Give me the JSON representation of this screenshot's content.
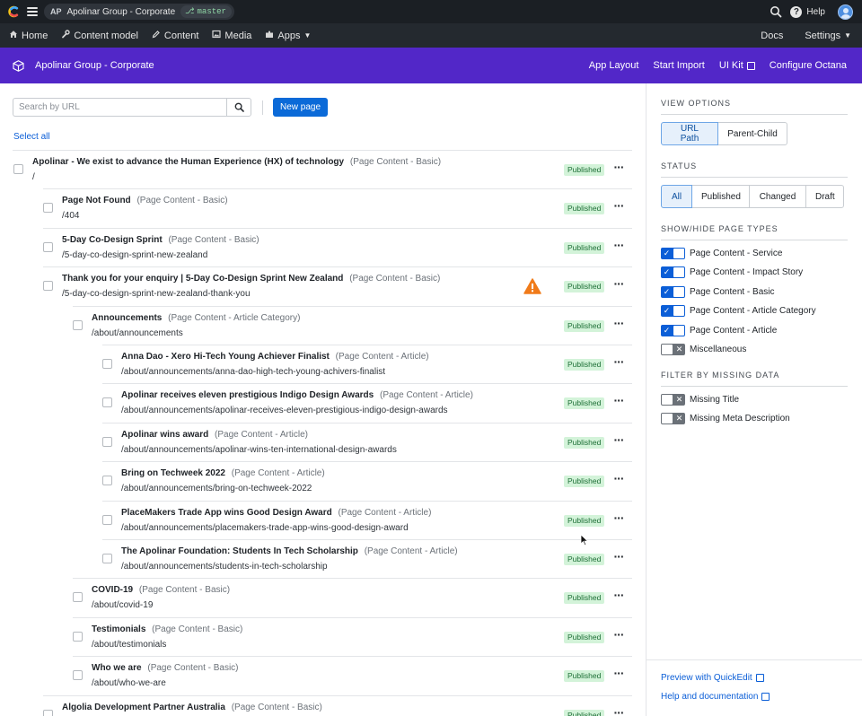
{
  "topbar": {
    "project_initials": "AP",
    "project_name": "Apolinar Group - Corporate",
    "branch": "master",
    "help_label": "Help",
    "icons": [
      "contentful-logo",
      "hamburger-icon",
      "branch-icon",
      "search-icon",
      "help-icon",
      "avatar"
    ]
  },
  "nav": {
    "home": "Home",
    "content_model": "Content model",
    "content": "Content",
    "media": "Media",
    "apps": "Apps",
    "docs": "Docs",
    "settings": "Settings"
  },
  "header": {
    "title": "Apolinar Group - Corporate",
    "links": {
      "app_layout": "App Layout",
      "start_import": "Start Import",
      "ui_kit": "UI Kit",
      "configure": "Configure Octana"
    },
    "accent": "#5227c8"
  },
  "toolbar": {
    "search_placeholder": "Search by URL",
    "new_page": "New page",
    "select_all": "Select all"
  },
  "rows": [
    {
      "title": "Apolinar - We exist to advance the Human Experience (HX) of technology",
      "type": "(Page Content - Basic)",
      "path": "/",
      "status": "Published"
    },
    {
      "title": "Page Not Found",
      "type": "(Page Content - Basic)",
      "path": "/404",
      "status": "Published"
    },
    {
      "title": "5-Day Co-Design Sprint",
      "type": "(Page Content - Basic)",
      "path": "/5-day-co-design-sprint-new-zealand",
      "status": "Published"
    },
    {
      "title": "Thank you for your enquiry | 5-Day Co-Design Sprint New Zealand",
      "type": "(Page Content - Basic)",
      "path": "/5-day-co-design-sprint-new-zealand-thank-you",
      "status": "Published",
      "warning": true
    },
    {
      "title": "Announcements",
      "type": "(Page Content - Article Category)",
      "path": "/about/announcements",
      "status": "Published"
    },
    {
      "title": "Anna Dao - Xero Hi-Tech Young Achiever Finalist",
      "type": "(Page Content - Article)",
      "path": "/about/announcements/anna-dao-high-tech-young-achivers-finalist",
      "status": "Published"
    },
    {
      "title": "Apolinar receives eleven prestigious Indigo Design Awards",
      "type": "(Page Content - Article)",
      "path": "/about/announcements/apolinar-receives-eleven-prestigious-indigo-design-awards",
      "status": "Published"
    },
    {
      "title": "Apolinar wins award",
      "type": "(Page Content - Article)",
      "path": "/about/announcements/apolinar-wins-ten-international-design-awards",
      "status": "Published"
    },
    {
      "title": "Bring on Techweek 2022",
      "type": "(Page Content - Article)",
      "path": "/about/announcements/bring-on-techweek-2022",
      "status": "Published"
    },
    {
      "title": "PlaceMakers Trade App wins Good Design Award",
      "type": "(Page Content - Article)",
      "path": "/about/announcements/placemakers-trade-app-wins-good-design-award",
      "status": "Published"
    },
    {
      "title": "The Apolinar Foundation: Students In Tech Scholarship",
      "type": "(Page Content - Article)",
      "path": "/about/announcements/students-in-tech-scholarship",
      "status": "Published"
    },
    {
      "title": "COVID-19",
      "type": "(Page Content - Basic)",
      "path": "/about/covid-19",
      "status": "Published"
    },
    {
      "title": "Testimonials",
      "type": "(Page Content - Basic)",
      "path": "/about/testimonials",
      "status": "Published"
    },
    {
      "title": "Who we are",
      "type": "(Page Content - Basic)",
      "path": "/about/who-we-are",
      "status": "Published"
    },
    {
      "title": "Algolia Development Partner Australia",
      "type": "(Page Content - Basic)",
      "path": "",
      "status": "Published"
    }
  ],
  "sidebar": {
    "view_options": {
      "title": "VIEW OPTIONS",
      "buttons": [
        "URL Path",
        "Parent-Child"
      ],
      "active": "URL Path"
    },
    "status": {
      "title": "STATUS",
      "buttons": [
        "All",
        "Published",
        "Changed",
        "Draft"
      ],
      "active": "All"
    },
    "page_types": {
      "title": "SHOW/HIDE PAGE TYPES",
      "items": [
        {
          "label": "Page Content - Service",
          "on": true
        },
        {
          "label": "Page Content - Impact Story",
          "on": true
        },
        {
          "label": "Page Content - Basic",
          "on": true
        },
        {
          "label": "Page Content - Article Category",
          "on": true
        },
        {
          "label": "Page Content - Article",
          "on": true
        },
        {
          "label": "Miscellaneous",
          "on": false
        }
      ]
    },
    "missing": {
      "title": "FILTER BY MISSING DATA",
      "items": [
        {
          "label": "Missing Title",
          "on": false
        },
        {
          "label": "Missing Meta Description",
          "on": false
        }
      ]
    },
    "links": {
      "preview": "Preview with QuickEdit",
      "help": "Help and documentation"
    }
  },
  "colors": {
    "primary_button": "#0b6ad8",
    "published_badge_bg": "#d3f3d9",
    "published_badge_text": "#1c6e35",
    "warning": "#f07b1a"
  }
}
